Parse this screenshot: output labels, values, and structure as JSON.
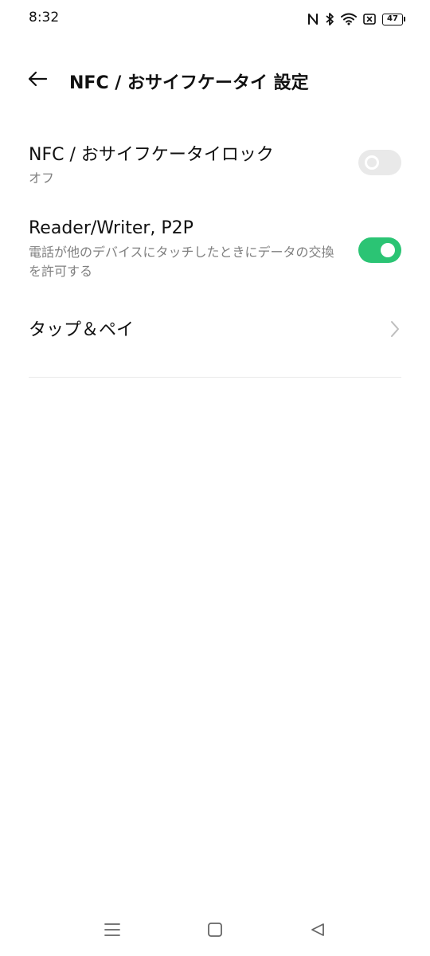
{
  "status_bar": {
    "time": "8:32",
    "battery_level": "47",
    "icons": [
      "nfc-icon",
      "bluetooth-icon",
      "wifi-icon",
      "sim-off-icon",
      "battery-icon"
    ]
  },
  "header": {
    "back_icon": "arrow-left-icon",
    "title": "NFC / おサイフケータイ 設定"
  },
  "settings": {
    "nfc_lock": {
      "title": "NFC / おサイフケータイロック",
      "subtitle": "オフ",
      "enabled": false
    },
    "reader_writer": {
      "title": "Reader/Writer, P2P",
      "subtitle": "電話が他のデバイスにタッチしたときにデータの交換を許可する",
      "enabled": true
    },
    "tap_and_pay": {
      "title": "タップ＆ペイ",
      "icon": "chevron-right-icon"
    }
  },
  "colors": {
    "toggle_on": "#2bc474",
    "toggle_off": "#e9e9e9",
    "subtitle": "#808080"
  },
  "nav_bar": {
    "icons": [
      "menu-icon",
      "home-icon",
      "back-triangle-icon"
    ]
  }
}
